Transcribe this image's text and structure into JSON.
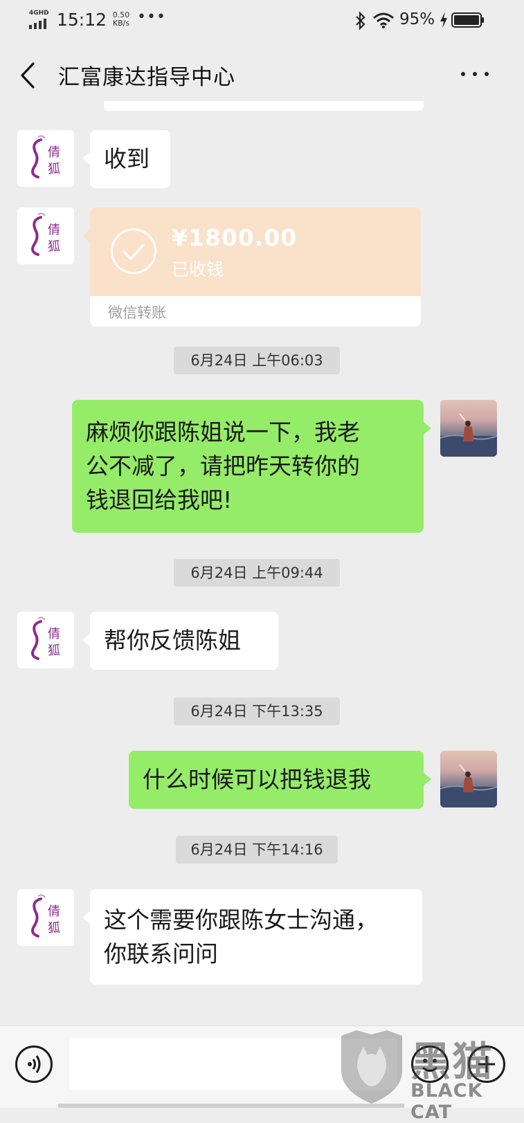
{
  "status_bar": {
    "network": "4GHD",
    "time": "15:12",
    "speed_value": "0.50",
    "speed_unit": "KB/s",
    "battery": "95%"
  },
  "header": {
    "title": "汇富康达指导中心"
  },
  "messages": [
    {
      "type": "text",
      "side": "left",
      "text": "收到"
    },
    {
      "type": "transfer",
      "side": "left",
      "amount": "¥1800.00",
      "status": "已收钱",
      "label": "微信转账"
    },
    {
      "type": "time",
      "text": "6月24日 上午06:03"
    },
    {
      "type": "text",
      "side": "right",
      "lines": [
        "麻烦你跟陈姐说一下，我老",
        "公不减了，请把昨天转你的",
        "钱退回给我吧!"
      ]
    },
    {
      "type": "time",
      "text": "6月24日 上午09:44"
    },
    {
      "type": "text",
      "side": "left",
      "text": "帮你反馈陈姐"
    },
    {
      "type": "time",
      "text": "6月24日 下午13:35"
    },
    {
      "type": "text",
      "side": "right",
      "text": "什么时候可以把钱退我"
    },
    {
      "type": "time",
      "text": "6月24日 下午14:16"
    },
    {
      "type": "text",
      "side": "left",
      "lines": [
        "这个需要你跟陈女士沟通，",
        "你联系问问"
      ]
    }
  ],
  "avatar_brand_text": [
    "倩",
    "狐"
  ],
  "watermark": {
    "cn": "黑猫",
    "en": "BLACK CAT"
  },
  "colors": {
    "background": "#ededed",
    "bubble_green": "#95ec69",
    "transfer_orange": "#fae1c9"
  }
}
